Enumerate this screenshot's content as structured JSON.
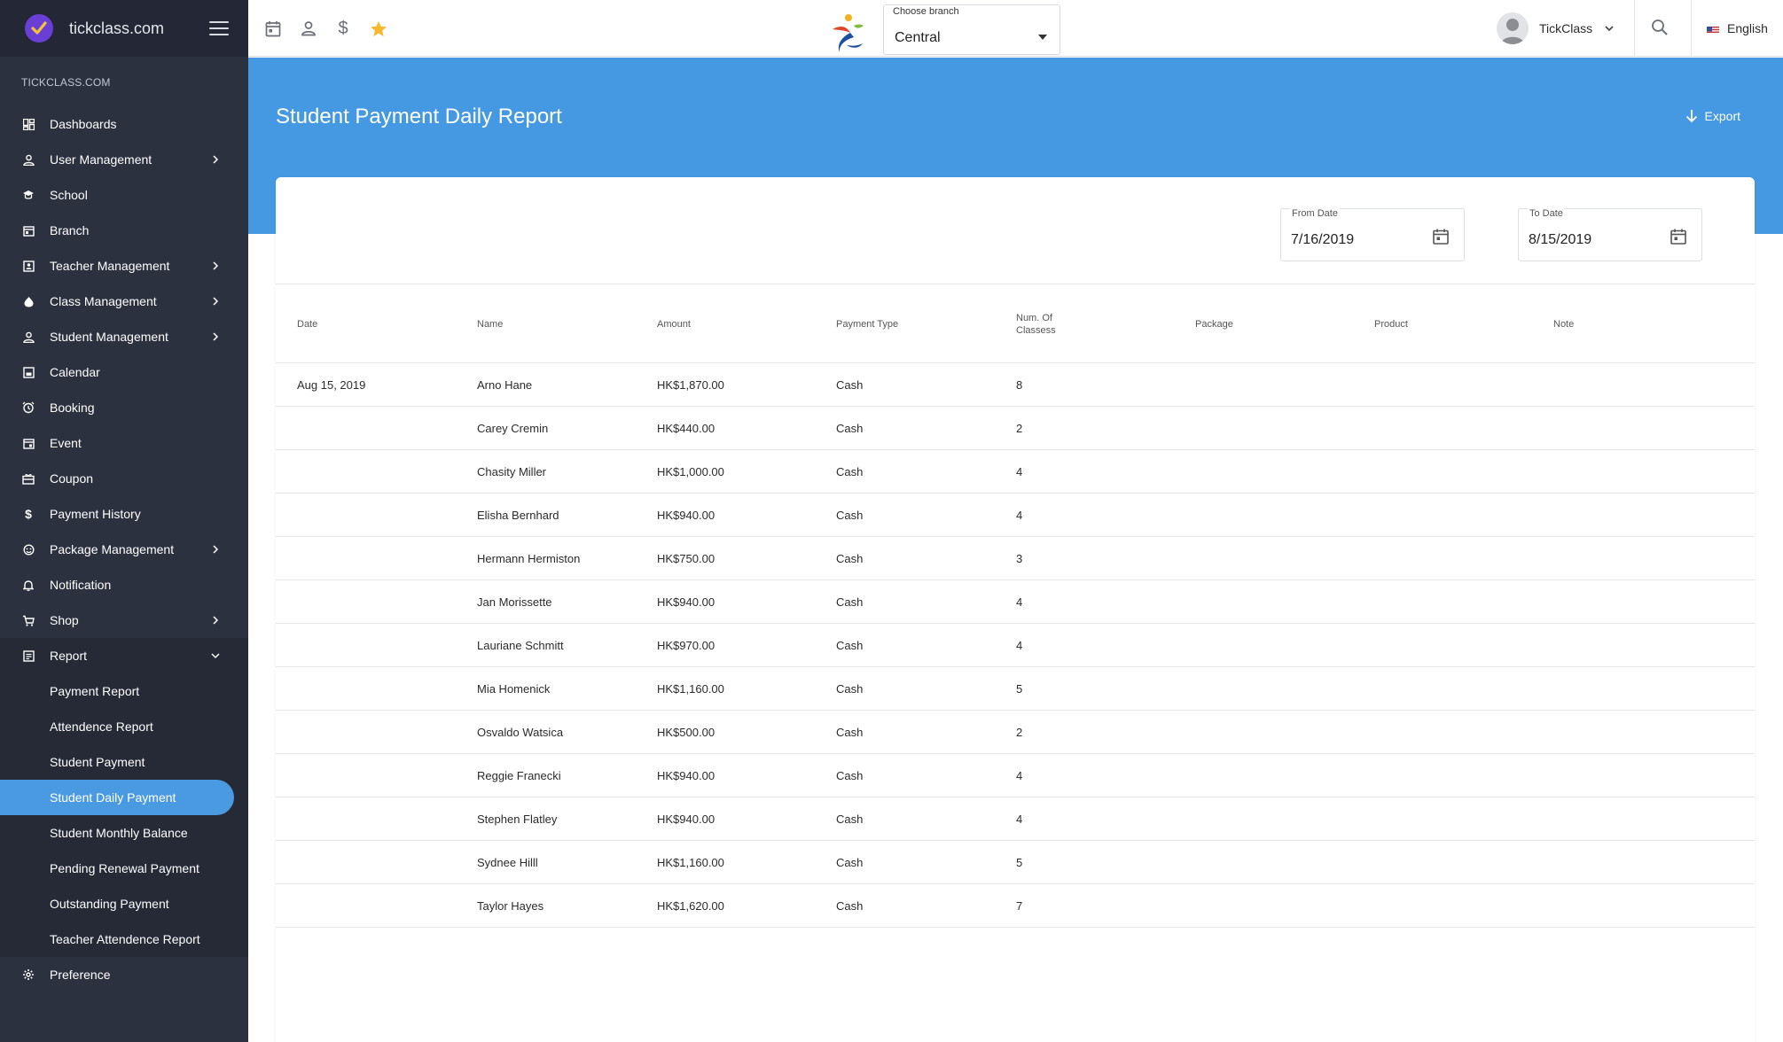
{
  "sidebar": {
    "brand_name": "tickclass.com",
    "section_title": "TICKCLASS.COM",
    "menu": [
      {
        "label": "Dashboards",
        "icon": "dashboard-icon"
      },
      {
        "label": "User Management",
        "icon": "user-icon",
        "has_children": true
      },
      {
        "label": "School",
        "icon": "school-icon"
      },
      {
        "label": "Branch",
        "icon": "branch-icon"
      },
      {
        "label": "Teacher Management",
        "icon": "teacher-icon",
        "has_children": true
      },
      {
        "label": "Class Management",
        "icon": "class-icon",
        "has_children": true
      },
      {
        "label": "Student Management",
        "icon": "student-icon",
        "has_children": true
      },
      {
        "label": "Calendar",
        "icon": "calendar-icon"
      },
      {
        "label": "Booking",
        "icon": "alarm-icon"
      },
      {
        "label": "Event",
        "icon": "event-icon"
      },
      {
        "label": "Coupon",
        "icon": "coupon-icon"
      },
      {
        "label": "Payment History",
        "icon": "dollar-icon"
      },
      {
        "label": "Package Management",
        "icon": "package-icon",
        "has_children": true
      },
      {
        "label": "Notification",
        "icon": "bell-icon"
      },
      {
        "label": "Shop",
        "icon": "cart-icon",
        "has_children": true
      },
      {
        "label": "Report",
        "icon": "report-icon",
        "expanded": true
      }
    ],
    "report_submenu": [
      "Payment Report",
      "Attendence Report",
      "Student Payment",
      "Student Daily Payment",
      "Student Monthly Balance",
      "Pending Renewal Payment",
      "Outstanding Payment",
      "Teacher Attendence Report"
    ],
    "active_submenu": "Student Daily Payment",
    "preference_label": "Preference"
  },
  "topbar": {
    "branch_label": "Choose branch",
    "branch_value": "Central",
    "user_name": "TickClass",
    "language": "English"
  },
  "page": {
    "title": "Student Payment Daily Report",
    "export_label": "Export"
  },
  "filters": {
    "from_label": "From Date",
    "from_value": "7/16/2019",
    "to_label": "To Date",
    "to_value": "8/15/2019"
  },
  "table": {
    "headers": [
      "Date",
      "Name",
      "Amount",
      "Payment Type",
      "Num. Of Classess",
      "Package",
      "Product",
      "Note"
    ],
    "rows": [
      [
        "Aug 15, 2019",
        "Arno Hane",
        "HK$1,870.00",
        "Cash",
        "8",
        "",
        "",
        ""
      ],
      [
        "",
        "Carey Cremin",
        "HK$440.00",
        "Cash",
        "2",
        "",
        "",
        ""
      ],
      [
        "",
        "Chasity Miller",
        "HK$1,000.00",
        "Cash",
        "4",
        "",
        "",
        ""
      ],
      [
        "",
        "Elisha Bernhard",
        "HK$940.00",
        "Cash",
        "4",
        "",
        "",
        ""
      ],
      [
        "",
        "Hermann Hermiston",
        "HK$750.00",
        "Cash",
        "3",
        "",
        "",
        ""
      ],
      [
        "",
        "Jan Morissette",
        "HK$940.00",
        "Cash",
        "4",
        "",
        "",
        ""
      ],
      [
        "",
        "Lauriane Schmitt",
        "HK$970.00",
        "Cash",
        "4",
        "",
        "",
        ""
      ],
      [
        "",
        "Mia Homenick",
        "HK$1,160.00",
        "Cash",
        "5",
        "",
        "",
        ""
      ],
      [
        "",
        "Osvaldo Watsica",
        "HK$500.00",
        "Cash",
        "2",
        "",
        "",
        ""
      ],
      [
        "",
        "Reggie Franecki",
        "HK$940.00",
        "Cash",
        "4",
        "",
        "",
        ""
      ],
      [
        "",
        "Stephen Flatley",
        "HK$940.00",
        "Cash",
        "4",
        "",
        "",
        ""
      ],
      [
        "",
        "Sydnee Hilll",
        "HK$1,160.00",
        "Cash",
        "5",
        "",
        "",
        ""
      ],
      [
        "",
        "Taylor Hayes",
        "HK$1,620.00",
        "Cash",
        "7",
        "",
        "",
        ""
      ]
    ]
  },
  "colors": {
    "sidebar_bg": "#2c3140",
    "accent_blue": "#4598e2",
    "active_item": "#4a9ae2",
    "star": "#f5b82e"
  }
}
